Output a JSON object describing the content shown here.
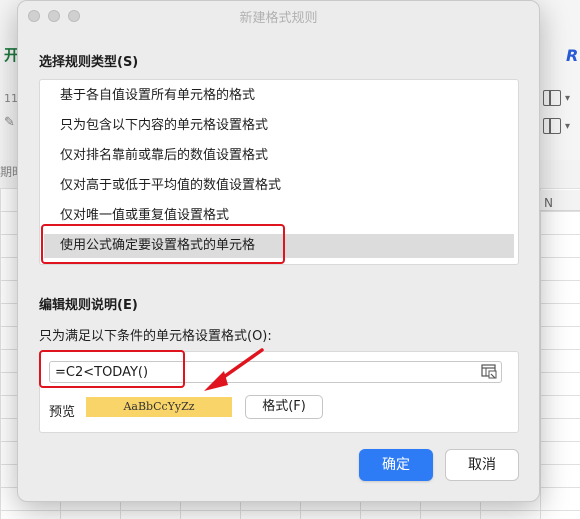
{
  "background": {
    "ribbon_tab_fragment": "开",
    "font_size_fragment": "11",
    "column_n": "N",
    "date_fragment": "期时",
    "brand_icon": "R"
  },
  "dialog": {
    "title": "新建格式规则",
    "section_type_label": "选择规则类型(S)",
    "rule_types": [
      {
        "label": "基于各自值设置所有单元格的格式"
      },
      {
        "label": "只为包含以下内容的单元格设置格式"
      },
      {
        "label": "仅对排名靠前或靠后的数值设置格式"
      },
      {
        "label": "仅对高于或低于平均值的数值设置格式"
      },
      {
        "label": "仅对唯一值或重复值设置格式"
      },
      {
        "label": "使用公式确定要设置格式的单元格"
      }
    ],
    "selected_rule_index": 5,
    "section_edit_label": "编辑规则说明(E)",
    "condition_label": "只为满足以下条件的单元格设置格式(O):",
    "formula_value": "=C2<TODAY()",
    "preview_label": "预览",
    "preview_sample": "AaBbCcYyZz",
    "preview_fill_color": "#f9d468",
    "format_button": "格式(F)",
    "ok_button": "确定",
    "cancel_button": "取消",
    "accent_color": "#2d7cf6",
    "annotation_color": "#e0141e"
  }
}
